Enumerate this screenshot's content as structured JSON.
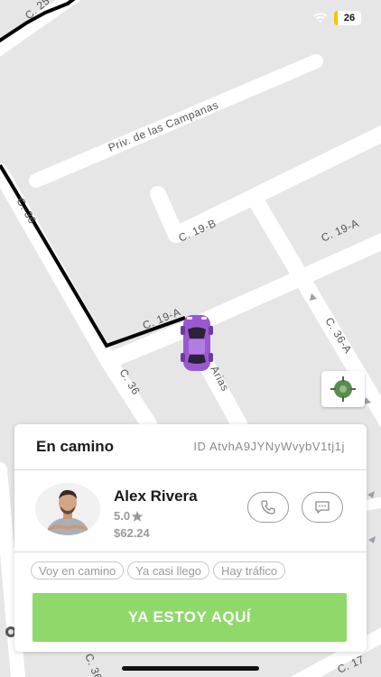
{
  "map": {
    "streets": [
      "C. 25",
      "Priv. de las Campanas",
      "C. 36",
      "C. 19-B",
      "C. 19-A",
      "C. 19-A",
      "C. 36-A",
      "C. 36",
      "Arias",
      "C. 36",
      "C. 17"
    ]
  },
  "status_bar": {
    "battery": "26",
    "battery_color": "#f4c400"
  },
  "card": {
    "title": "En camino",
    "ride_id": "ID AtvhA9JYNyWvybV1tj1j"
  },
  "driver": {
    "name": "Alex Rivera",
    "rating": "5.0",
    "fare": "$62.24"
  },
  "quick_replies": [
    "Voy en camino",
    "Ya casi llego",
    "Hay tráfico"
  ],
  "primary_action": "YA ESTOY AQUÍ",
  "colors": {
    "accent": "#8ed96a",
    "car": "#9b59d0",
    "route": "#000000"
  },
  "icons": [
    "wifi-icon",
    "battery-icon",
    "recenter-icon",
    "car-icon",
    "phone-icon",
    "chat-icon",
    "star-icon"
  ]
}
